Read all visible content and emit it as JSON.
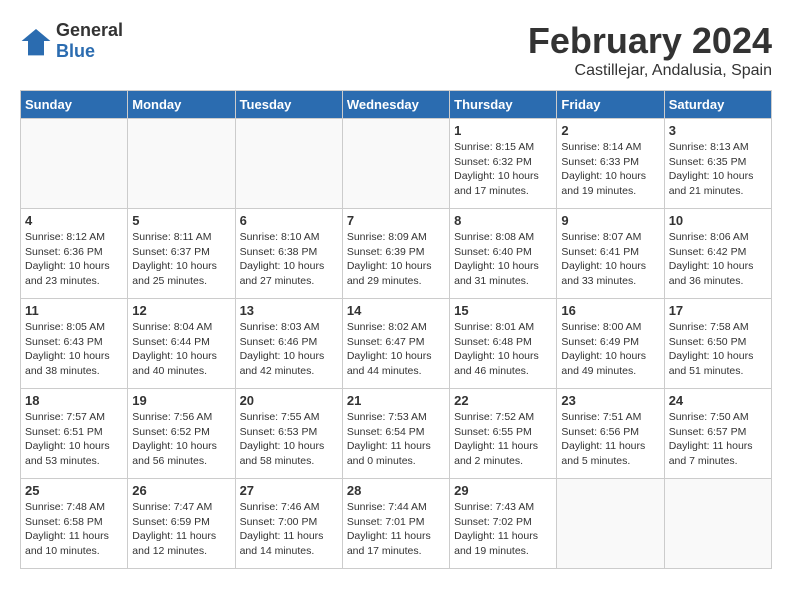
{
  "header": {
    "logo_general": "General",
    "logo_blue": "Blue",
    "month": "February 2024",
    "location": "Castillejar, Andalusia, Spain"
  },
  "days_of_week": [
    "Sunday",
    "Monday",
    "Tuesday",
    "Wednesday",
    "Thursday",
    "Friday",
    "Saturday"
  ],
  "weeks": [
    [
      {
        "day": "",
        "info": ""
      },
      {
        "day": "",
        "info": ""
      },
      {
        "day": "",
        "info": ""
      },
      {
        "day": "",
        "info": ""
      },
      {
        "day": "1",
        "info": "Sunrise: 8:15 AM\nSunset: 6:32 PM\nDaylight: 10 hours\nand 17 minutes."
      },
      {
        "day": "2",
        "info": "Sunrise: 8:14 AM\nSunset: 6:33 PM\nDaylight: 10 hours\nand 19 minutes."
      },
      {
        "day": "3",
        "info": "Sunrise: 8:13 AM\nSunset: 6:35 PM\nDaylight: 10 hours\nand 21 minutes."
      }
    ],
    [
      {
        "day": "4",
        "info": "Sunrise: 8:12 AM\nSunset: 6:36 PM\nDaylight: 10 hours\nand 23 minutes."
      },
      {
        "day": "5",
        "info": "Sunrise: 8:11 AM\nSunset: 6:37 PM\nDaylight: 10 hours\nand 25 minutes."
      },
      {
        "day": "6",
        "info": "Sunrise: 8:10 AM\nSunset: 6:38 PM\nDaylight: 10 hours\nand 27 minutes."
      },
      {
        "day": "7",
        "info": "Sunrise: 8:09 AM\nSunset: 6:39 PM\nDaylight: 10 hours\nand 29 minutes."
      },
      {
        "day": "8",
        "info": "Sunrise: 8:08 AM\nSunset: 6:40 PM\nDaylight: 10 hours\nand 31 minutes."
      },
      {
        "day": "9",
        "info": "Sunrise: 8:07 AM\nSunset: 6:41 PM\nDaylight: 10 hours\nand 33 minutes."
      },
      {
        "day": "10",
        "info": "Sunrise: 8:06 AM\nSunset: 6:42 PM\nDaylight: 10 hours\nand 36 minutes."
      }
    ],
    [
      {
        "day": "11",
        "info": "Sunrise: 8:05 AM\nSunset: 6:43 PM\nDaylight: 10 hours\nand 38 minutes."
      },
      {
        "day": "12",
        "info": "Sunrise: 8:04 AM\nSunset: 6:44 PM\nDaylight: 10 hours\nand 40 minutes."
      },
      {
        "day": "13",
        "info": "Sunrise: 8:03 AM\nSunset: 6:46 PM\nDaylight: 10 hours\nand 42 minutes."
      },
      {
        "day": "14",
        "info": "Sunrise: 8:02 AM\nSunset: 6:47 PM\nDaylight: 10 hours\nand 44 minutes."
      },
      {
        "day": "15",
        "info": "Sunrise: 8:01 AM\nSunset: 6:48 PM\nDaylight: 10 hours\nand 46 minutes."
      },
      {
        "day": "16",
        "info": "Sunrise: 8:00 AM\nSunset: 6:49 PM\nDaylight: 10 hours\nand 49 minutes."
      },
      {
        "day": "17",
        "info": "Sunrise: 7:58 AM\nSunset: 6:50 PM\nDaylight: 10 hours\nand 51 minutes."
      }
    ],
    [
      {
        "day": "18",
        "info": "Sunrise: 7:57 AM\nSunset: 6:51 PM\nDaylight: 10 hours\nand 53 minutes."
      },
      {
        "day": "19",
        "info": "Sunrise: 7:56 AM\nSunset: 6:52 PM\nDaylight: 10 hours\nand 56 minutes."
      },
      {
        "day": "20",
        "info": "Sunrise: 7:55 AM\nSunset: 6:53 PM\nDaylight: 10 hours\nand 58 minutes."
      },
      {
        "day": "21",
        "info": "Sunrise: 7:53 AM\nSunset: 6:54 PM\nDaylight: 11 hours\nand 0 minutes."
      },
      {
        "day": "22",
        "info": "Sunrise: 7:52 AM\nSunset: 6:55 PM\nDaylight: 11 hours\nand 2 minutes."
      },
      {
        "day": "23",
        "info": "Sunrise: 7:51 AM\nSunset: 6:56 PM\nDaylight: 11 hours\nand 5 minutes."
      },
      {
        "day": "24",
        "info": "Sunrise: 7:50 AM\nSunset: 6:57 PM\nDaylight: 11 hours\nand 7 minutes."
      }
    ],
    [
      {
        "day": "25",
        "info": "Sunrise: 7:48 AM\nSunset: 6:58 PM\nDaylight: 11 hours\nand 10 minutes."
      },
      {
        "day": "26",
        "info": "Sunrise: 7:47 AM\nSunset: 6:59 PM\nDaylight: 11 hours\nand 12 minutes."
      },
      {
        "day": "27",
        "info": "Sunrise: 7:46 AM\nSunset: 7:00 PM\nDaylight: 11 hours\nand 14 minutes."
      },
      {
        "day": "28",
        "info": "Sunrise: 7:44 AM\nSunset: 7:01 PM\nDaylight: 11 hours\nand 17 minutes."
      },
      {
        "day": "29",
        "info": "Sunrise: 7:43 AM\nSunset: 7:02 PM\nDaylight: 11 hours\nand 19 minutes."
      },
      {
        "day": "",
        "info": ""
      },
      {
        "day": "",
        "info": ""
      }
    ]
  ]
}
